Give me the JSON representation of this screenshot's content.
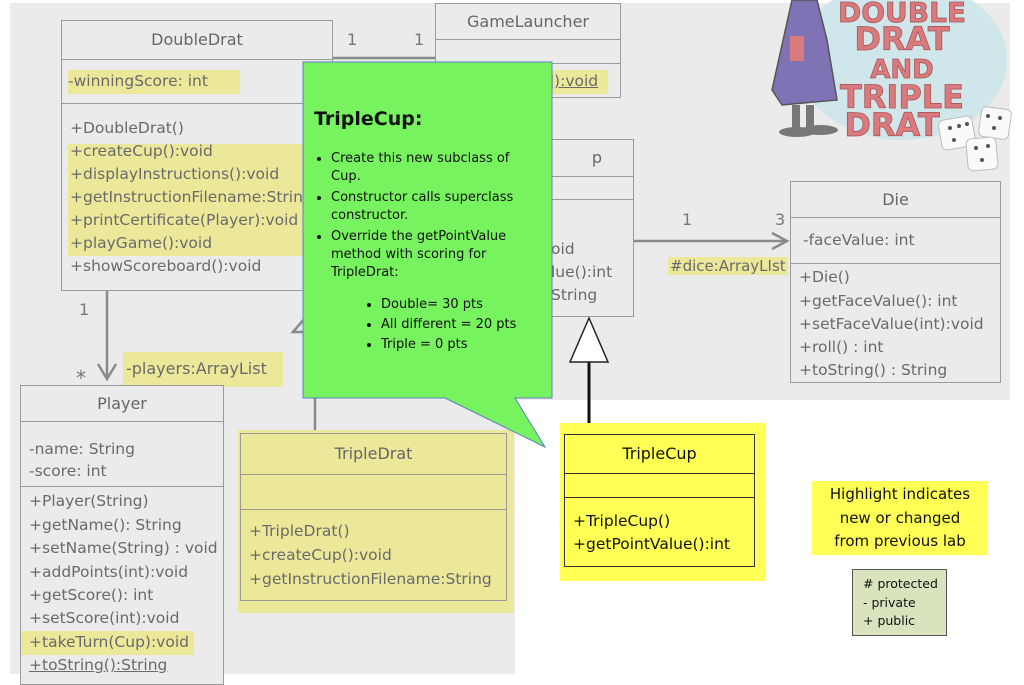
{
  "colors": {
    "highlight": "#ffff55",
    "faded_highlight": "#ebe89a",
    "callout": "#77f35f",
    "legend_bg": "#d9e3bd",
    "logo_text": "#d97a7e",
    "logo_coat": "#7f72b5"
  },
  "logo": {
    "text": [
      "DOUBLE",
      "DRAT",
      "AND",
      "TRIPLE",
      "DRAT"
    ]
  },
  "double_drat": {
    "name": "DoubleDrat",
    "attributes": [
      "-winningScore: int"
    ],
    "methods": [
      "+DoubleDrat()",
      "+createCup():void",
      "+displayInstructions():void",
      "+getInstructionFilename:String",
      "+printCertificate(Player):void",
      "+playGame():void",
      "+showScoreboard():void"
    ]
  },
  "game_launcher": {
    "name": "GameLauncher",
    "methods": [
      "]):void"
    ]
  },
  "assoc_dd_gl": {
    "left_mult": "1",
    "right_mult": "1"
  },
  "cup": {
    "name": "p",
    "methods": [
      "oid",
      "lue():int",
      "String"
    ]
  },
  "assoc_cup_die": {
    "left_mult": "1",
    "right_mult": "3",
    "role": "#dice:ArrayLIst"
  },
  "die": {
    "name": "Die",
    "attributes": [
      "-faceValue: int"
    ],
    "methods": [
      "+Die()",
      "+getFaceValue(): int",
      "+setFaceValue(int):void",
      "+roll() : int",
      "+toString() : String"
    ]
  },
  "assoc_dd_player": {
    "left_mult": "1",
    "right_mult": "*",
    "role": "-players:ArrayList"
  },
  "player": {
    "name": "Player",
    "attributes": [
      "-name: String",
      "-score: int"
    ],
    "methods": [
      "+Player(String)",
      "+getName(): String",
      "+setName(String) : void",
      "+addPoints(int):void",
      "+getScore(): int",
      "+setScore(int):void",
      "+takeTurn(Cup):void",
      "+toString():String"
    ]
  },
  "triple_drat": {
    "name": "TripleDrat",
    "methods": [
      "+TripleDrat()",
      "+createCup():void",
      "+getInstructionFilename:String"
    ]
  },
  "triple_cup": {
    "name": "TripleCup",
    "methods": [
      "+TripleCup()",
      "+getPointValue():int"
    ]
  },
  "callout": {
    "title": "TripleCup:",
    "bullets": [
      "Create this new subclass of Cup.",
      "Constructor calls superclass constructor.",
      "Override the getPointValue method with scoring for TripleDrat:"
    ],
    "sub_bullets": [
      "Double= 30 pts",
      "All different = 20 pts",
      "Triple = 0  pts"
    ]
  },
  "note": {
    "text": [
      "Highlight indicates",
      "new or changed",
      "from previous lab"
    ]
  },
  "legend": {
    "items": [
      "# protected",
      "- private",
      "+ public"
    ]
  }
}
